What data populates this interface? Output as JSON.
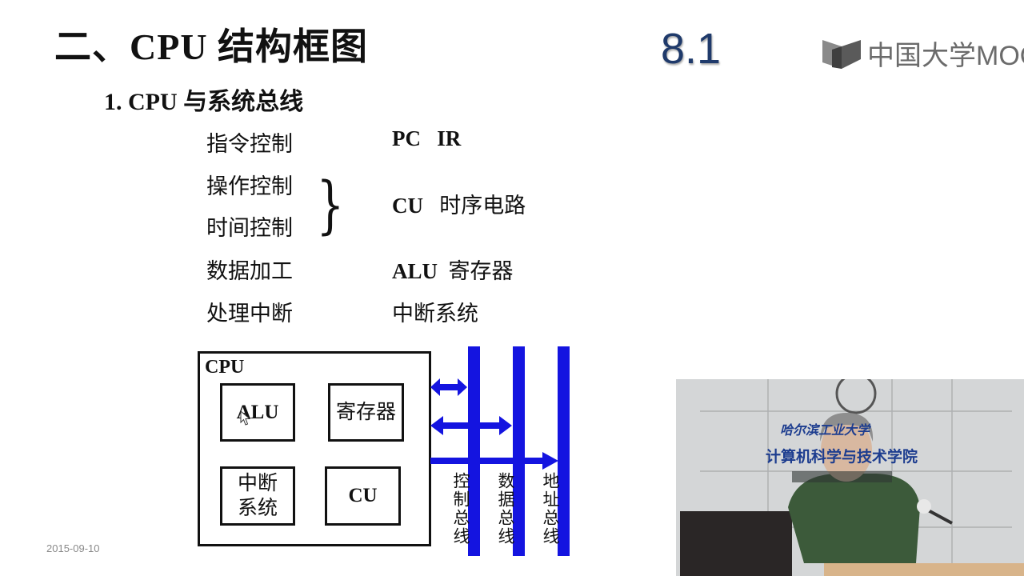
{
  "slide": {
    "title": "二、CPU 结构框图",
    "subtitle": "1.  CPU 与系统总线",
    "section_number": "8.1",
    "date": "2015-09-10",
    "logo_text": "中国大学MOOC",
    "functions": [
      {
        "left": "指令控制",
        "right_bold": "PC   IR",
        "right_text": ""
      },
      {
        "left": "操作控制",
        "right_bold": "",
        "right_text": ""
      },
      {
        "left": "时间控制",
        "right_bold": "",
        "right_text": ""
      },
      {
        "left": "数据加工",
        "right_bold": "ALU",
        "right_text": "寄存器"
      },
      {
        "left": "处理中断",
        "right_bold": "",
        "right_text": "中断系统"
      }
    ],
    "grouped_right": {
      "bold": "CU",
      "text": "时序电路"
    },
    "brace": "}"
  },
  "diagram": {
    "cpu_label": "CPU",
    "units": {
      "alu": "ALU",
      "registers": "寄存器",
      "interrupt": [
        "中断",
        "系统"
      ],
      "cu": "CU"
    },
    "buses": {
      "control": "控制总线",
      "data": "数据总线",
      "address": "地址总线"
    },
    "bus_color": "#1414e0"
  },
  "video": {
    "wall_text_1": "哈尔滨工业大学",
    "wall_text_2": "计算机科学与技术学院"
  }
}
